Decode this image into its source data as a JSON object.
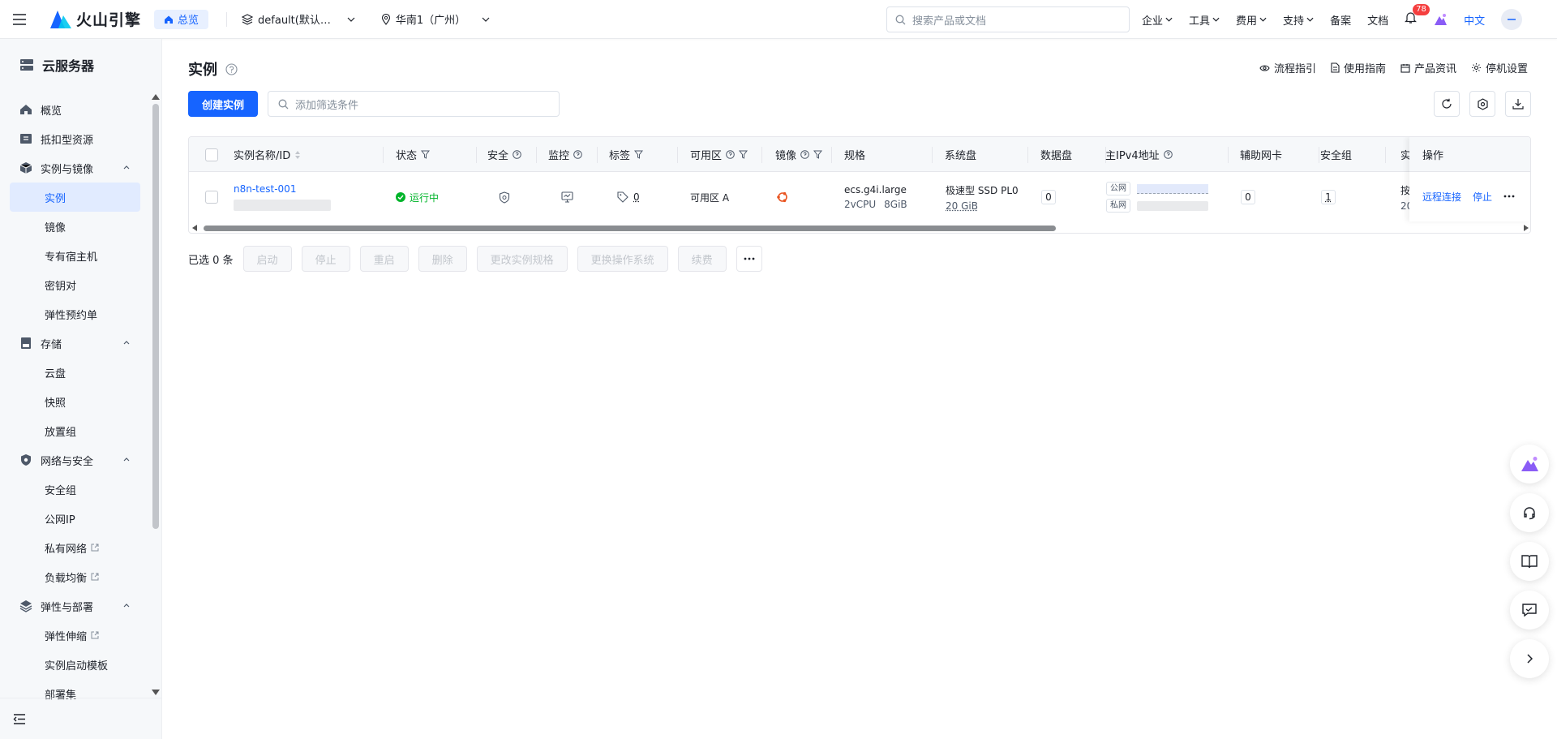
{
  "header": {
    "brand": "火山引擎",
    "home_label": "总览",
    "project": "default(默认…",
    "region": "华南1（广州）",
    "search_placeholder": "搜索产品或文档",
    "nav": [
      "企业",
      "工具",
      "费用",
      "支持",
      "备案",
      "文档"
    ],
    "notification_count": "78",
    "language": "中文"
  },
  "sidebar": {
    "title": "云服务器",
    "groups": {
      "overview": "概览",
      "deduction": "抵扣型资源",
      "instances_images": "实例与镜像",
      "storage": "存储",
      "network_security": "网络与安全",
      "elastic_deploy": "弹性与部署"
    },
    "items": {
      "instance": "实例",
      "image": "镜像",
      "dedicated_host": "专有宿主机",
      "keypair": "密钥对",
      "elastic_reservation": "弹性预约单",
      "cloud_disk": "云盘",
      "snapshot": "快照",
      "placement_group": "放置组",
      "security_group": "安全组",
      "public_ip": "公网IP",
      "vpc": "私有网络",
      "load_balancer": "负载均衡",
      "autoscaling": "弹性伸缩",
      "launch_template": "实例启动模板",
      "deployment_set": "部署集"
    }
  },
  "page": {
    "title": "实例",
    "help_links": [
      "流程指引",
      "使用指南",
      "产品资讯",
      "停机设置"
    ],
    "create_button": "创建实例",
    "filter_placeholder": "添加筛选条件"
  },
  "table": {
    "columns": {
      "name": "实例名称/ID",
      "status": "状态",
      "security": "安全",
      "monitor": "监控",
      "tags": "标签",
      "zone": "可用区",
      "image": "镜像",
      "spec": "规格",
      "system_disk": "系统盘",
      "data_disk": "数据盘",
      "ipv4": "主IPv4地址",
      "secondary_nic": "辅助网卡",
      "security_group": "安全组",
      "truncated": "实",
      "ops": "操作"
    },
    "row": {
      "name": "n8n-test-001",
      "status": "运行中",
      "tag_count": "0",
      "zone": "可用区 A",
      "spec_type": "ecs.g4i.large",
      "spec_cpu": "2vCPU",
      "spec_mem": "8GiB",
      "system_disk_type": "极速型 SSD PL0",
      "system_disk_size": "20 GiB",
      "data_disk_count": "0",
      "ip_public_label": "公网",
      "ip_private_label": "私网",
      "secondary_nic_count": "0",
      "security_group_count": "1",
      "truncated_top": "按",
      "truncated_bottom": "20",
      "op_connect": "远程连接",
      "op_stop": "停止"
    }
  },
  "batch": {
    "selected": "已选 0 条",
    "buttons": [
      "启动",
      "停止",
      "重启",
      "删除",
      "更改实例规格",
      "更换操作系统",
      "续费"
    ]
  },
  "colors": {
    "accent": "#1664ff",
    "running": "#00b42a",
    "ubuntu": "#e95420",
    "badge": "#f53f3f"
  }
}
